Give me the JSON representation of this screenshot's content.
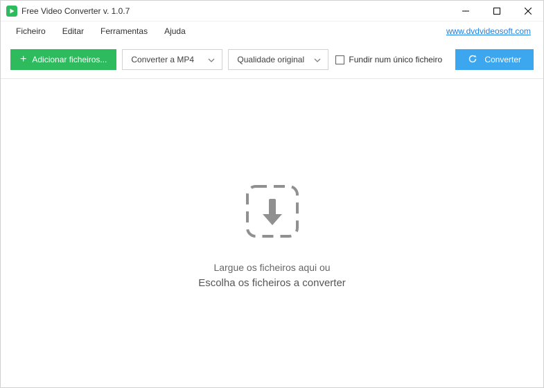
{
  "titlebar": {
    "title": "Free Video Converter v. 1.0.7"
  },
  "menubar": {
    "file": "Ficheiro",
    "edit": "Editar",
    "tools": "Ferramentas",
    "help": "Ajuda",
    "site_link": "www.dvdvideosoft.com"
  },
  "toolbar": {
    "add_files": "Adicionar ficheiros...",
    "format_selected": "Converter a MP4",
    "quality_selected": "Qualidade original",
    "merge_label": "Fundir num único ficheiro",
    "merge_checked": false,
    "convert": "Converter"
  },
  "dropzone": {
    "line1": "Largue os ficheiros aqui ou",
    "line2": "Escolha os ficheiros a converter"
  }
}
